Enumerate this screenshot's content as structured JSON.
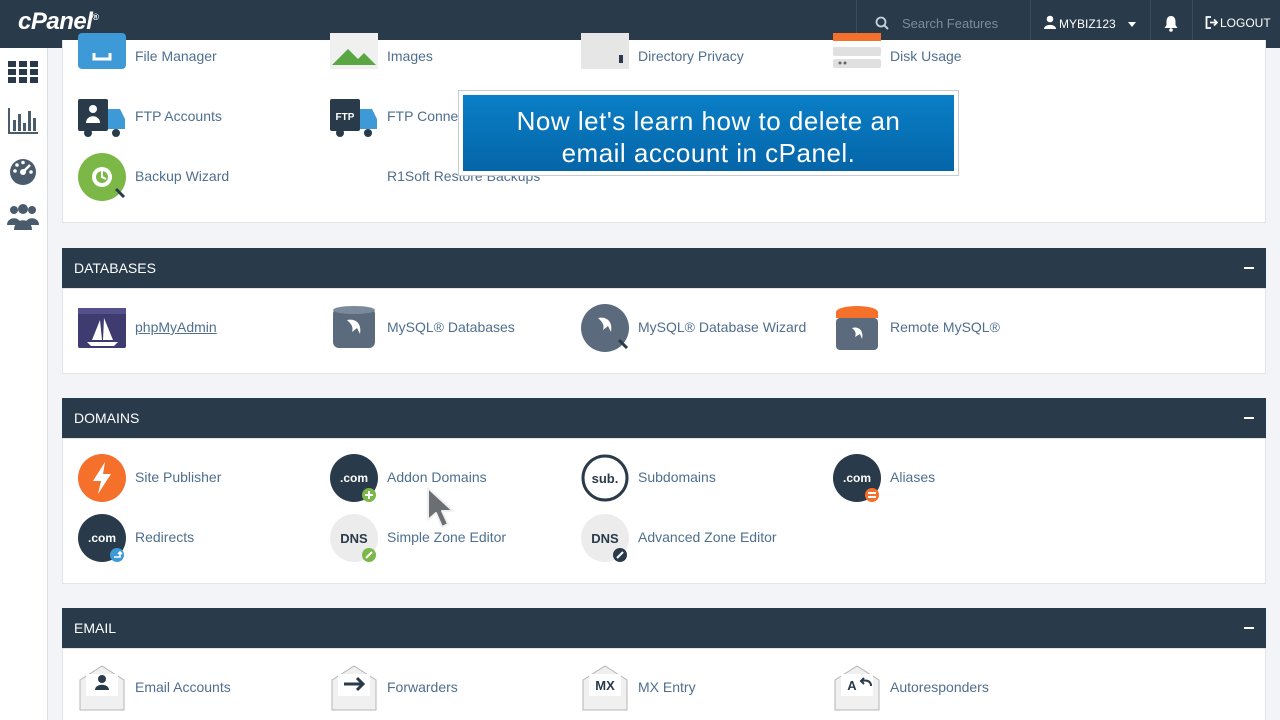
{
  "topbar": {
    "logo": "cPanel",
    "search_placeholder": "Search Features",
    "username": "MYBIZ123",
    "logout": "LOGOUT"
  },
  "sidebar": {
    "icons": [
      "grid-icon",
      "stats-icon",
      "dashboard-icon",
      "users-icon"
    ]
  },
  "files_partial": {
    "items": [
      "File Manager",
      "Images",
      "Directory Privacy",
      "Disk Usage",
      "FTP Accounts",
      "FTP Connections",
      "Backup Wizard",
      "R1Soft Restore Backups"
    ],
    "visible_labels": {
      "file_manager": "File Manager",
      "images": "Images",
      "directory_privacy": "Directory Privacy",
      "disk_usage": "Disk Usage",
      "ftp_accounts": "FTP Accounts",
      "ftp_connections": "FTP Conne",
      "backup_wizard": "Backup Wizard",
      "r1soft": "R1Soft Restore Backups"
    }
  },
  "databases": {
    "title": "DATABASES",
    "items": [
      "phpMyAdmin",
      "MySQL® Databases",
      "MySQL® Database Wizard",
      "Remote MySQL®"
    ]
  },
  "domains": {
    "title": "DOMAINS",
    "items": [
      "Site Publisher",
      "Addon Domains",
      "Subdomains",
      "Aliases",
      "Redirects",
      "Simple Zone Editor",
      "Advanced Zone Editor"
    ]
  },
  "email": {
    "title": "EMAIL",
    "items": [
      "Email Accounts",
      "Forwarders",
      "MX Entry",
      "Autoresponders"
    ]
  },
  "banner": {
    "line1": "Now let's learn how to delete an",
    "line2": "email account in cPanel."
  },
  "colors": {
    "header": "#293a4a",
    "link": "#4f6f8f",
    "accent_orange": "#f5702a",
    "banner_blue": "#0a7fc7"
  }
}
